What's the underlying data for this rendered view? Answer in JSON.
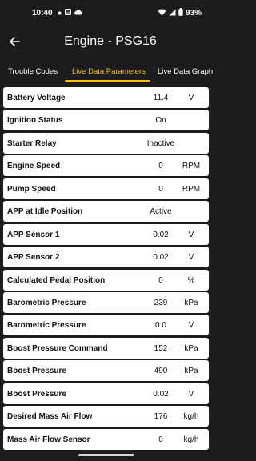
{
  "status_bar": {
    "time": "10:40",
    "battery": "93%",
    "left_icons": [
      "notification-dot-icon",
      "sim-icon",
      "cloud-icon"
    ],
    "right_icons": [
      "wifi-icon",
      "signal-icon",
      "battery-icon"
    ]
  },
  "app_bar": {
    "title": "Engine - PSG16",
    "back_icon": "arrow-back-icon"
  },
  "tabs": [
    {
      "label": "Trouble Codes",
      "active": false
    },
    {
      "label": "Live Data Parameters",
      "active": true
    },
    {
      "label": "Live Data Graphs",
      "active": false
    }
  ],
  "colors": {
    "background": "#1c1c1c",
    "accent": "#f3c300",
    "row_bg": "#ffffff",
    "text_dark": "#111111"
  },
  "parameters": [
    {
      "label": "Battery Voltage",
      "value": "11.4",
      "unit": "V"
    },
    {
      "label": "Ignition Status",
      "value": "On",
      "unit": ""
    },
    {
      "label": "Starter Relay",
      "value": "Inactive",
      "unit": ""
    },
    {
      "label": "Engine Speed",
      "value": "0",
      "unit": "RPM"
    },
    {
      "label": "Pump Speed",
      "value": "0",
      "unit": "RPM"
    },
    {
      "label": "APP at Idle Position",
      "value": "Active",
      "unit": ""
    },
    {
      "label": "APP Sensor 1",
      "value": "0.02",
      "unit": "V"
    },
    {
      "label": "APP Sensor 2",
      "value": "0.02",
      "unit": "V"
    },
    {
      "label": "Calculated Pedal Position",
      "value": "0",
      "unit": "%"
    },
    {
      "label": "Barometric Pressure",
      "value": "239",
      "unit": "kPa"
    },
    {
      "label": "Barometric Pressure",
      "value": "0.0",
      "unit": "V"
    },
    {
      "label": "Boost Pressure Command",
      "value": "152",
      "unit": "kPa"
    },
    {
      "label": "Boost Pressure",
      "value": "490",
      "unit": "kPa"
    },
    {
      "label": "Boost Pressure",
      "value": "0.02",
      "unit": "V"
    },
    {
      "label": "Desired Mass Air Flow",
      "value": "176",
      "unit": "kg/h"
    },
    {
      "label": "Mass Air Flow Sensor",
      "value": "0",
      "unit": "kg/h"
    }
  ]
}
